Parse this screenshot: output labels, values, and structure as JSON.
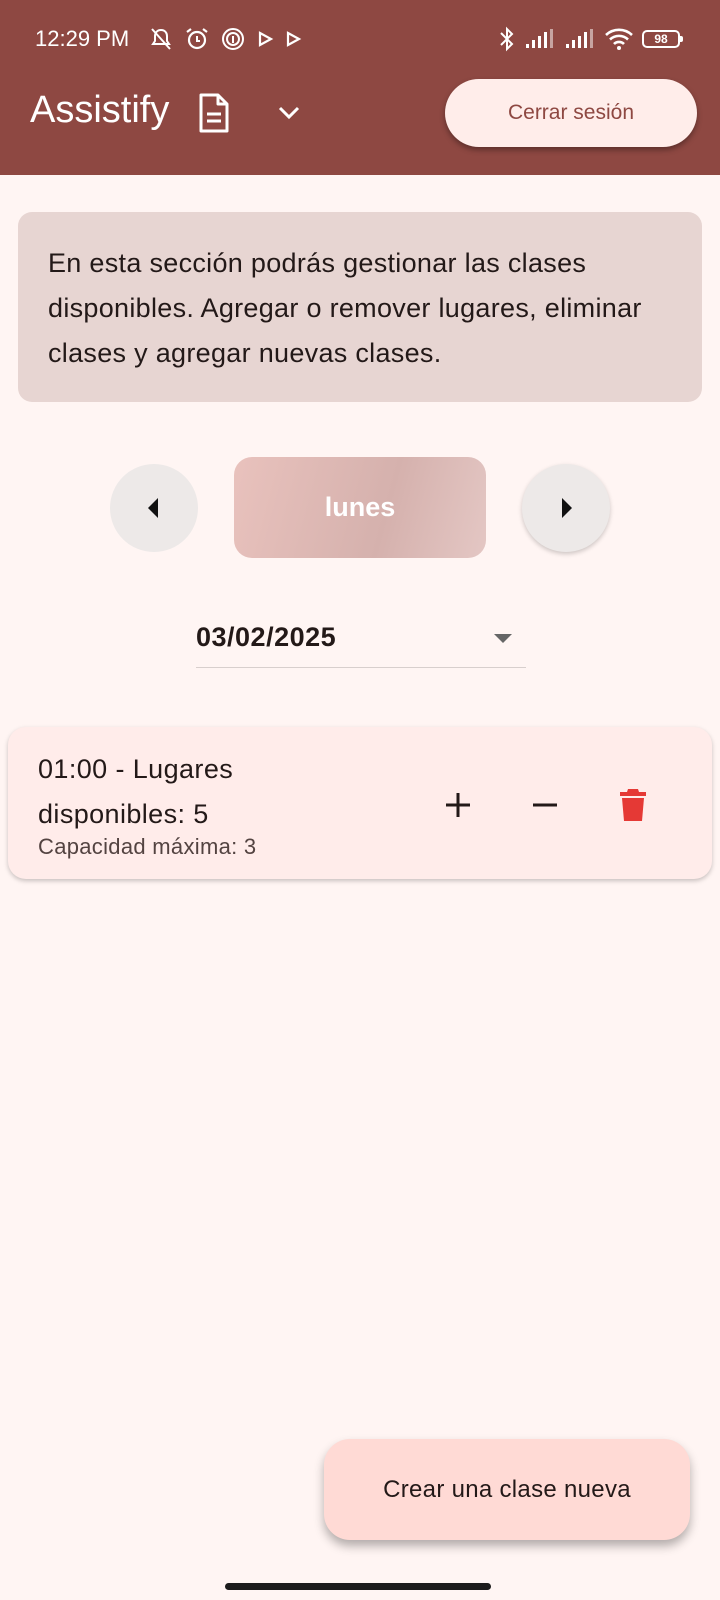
{
  "status_bar": {
    "time": "12:29 PM",
    "battery": "98",
    "icons": [
      "notifications-off-icon",
      "alarm-icon",
      "fingerprint-icon",
      "play-icon",
      "play-icon",
      "bluetooth-icon",
      "signal-icon",
      "signal-icon",
      "wifi-icon",
      "battery-icon"
    ]
  },
  "app_bar": {
    "title": "Assistify",
    "title_icon": "document-icon",
    "dropdown_icon": "chevron-down-icon",
    "logout_label": "Cerrar sesión"
  },
  "info": {
    "text": "En esta sección podrás gestionar las clases disponibles. Agregar o remover lugares, eliminar clases y agregar nuevas clases."
  },
  "day_nav": {
    "prev_icon": "arrow-left-icon",
    "day": "lunes",
    "next_icon": "arrow-right-icon"
  },
  "date_selector": {
    "value": "03/02/2025"
  },
  "classes": [
    {
      "title": "01:00 - Lugares disponibles: 5",
      "subtitle": "Capacidad máxima: 3"
    }
  ],
  "fab": {
    "label": "Crear una clase nueva"
  },
  "colors": {
    "primary": "#8e4842",
    "background": "#fff5f3",
    "info_bg": "#e7d5d2",
    "card_bg": "#ffecea",
    "fab_bg": "#ffdad5",
    "delete": "#e53935"
  }
}
